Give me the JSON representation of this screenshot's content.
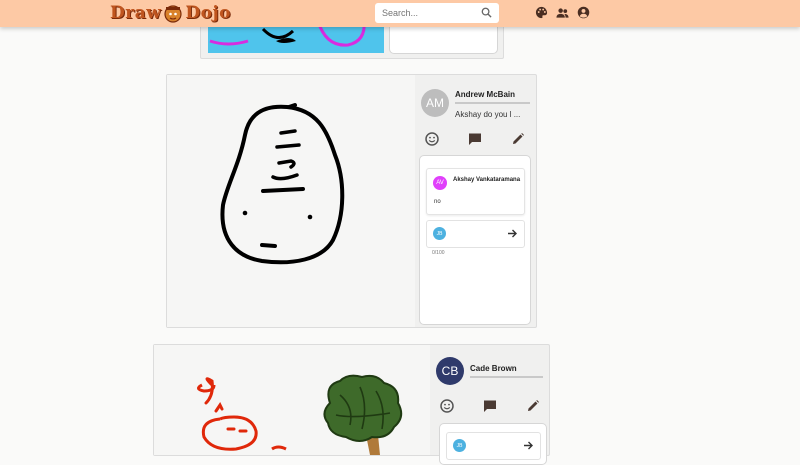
{
  "app": {
    "logo_left": "Draw",
    "logo_right": "Dojo",
    "search_placeholder": "Search...",
    "icons": [
      "palette-icon",
      "friends-icon",
      "account-icon"
    ],
    "colors": {
      "topbar": "#fdc9a5",
      "logo": "#c0551f"
    }
  },
  "posts": [
    {
      "author": "Andrew McBain",
      "avatar_initials": "AM",
      "avatar_color": "#bdbdbd",
      "caption": "Akshay do you l ...",
      "comments": [
        {
          "author": "Akshay Vankataramana",
          "avatar_initials": "AV",
          "avatar_color": "#e040fb",
          "text": "no"
        }
      ],
      "input_avatar_initials": "JB",
      "char_counter": "0/100"
    },
    {
      "author": "Cade Brown",
      "avatar_initials": "CB",
      "avatar_color": "#2f3a6b",
      "input_avatar_initials": "JB"
    }
  ]
}
